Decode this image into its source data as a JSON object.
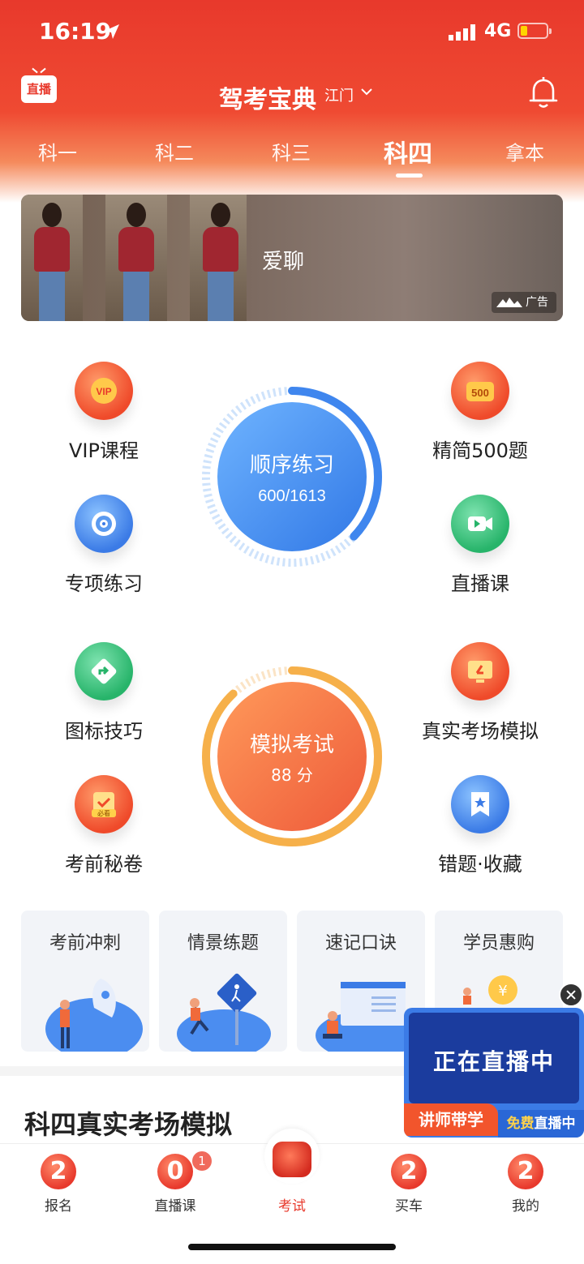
{
  "status": {
    "time": "16:19",
    "network": "4G"
  },
  "header": {
    "live_badge": "直播",
    "title": "驾考宝典",
    "city": "江门"
  },
  "tabs": [
    {
      "label": "科一"
    },
    {
      "label": "科二"
    },
    {
      "label": "科三"
    },
    {
      "label": "科四",
      "active": true
    },
    {
      "label": "拿本"
    }
  ],
  "banner": {
    "text": "爱聊",
    "ad_label": "广告"
  },
  "features_left": [
    {
      "label": "VIP课程",
      "icon": "vip-icon"
    },
    {
      "label": "专项练习",
      "icon": "target-icon"
    },
    {
      "label": "图标技巧",
      "icon": "road-sign-icon"
    },
    {
      "label": "考前秘卷",
      "icon": "clipboard-check-icon",
      "sub": "必看"
    }
  ],
  "features_right": [
    {
      "label": "精简500题",
      "icon": "500-badge-icon",
      "sub": "500"
    },
    {
      "label": "直播课",
      "icon": "video-camera-icon"
    },
    {
      "label": "真实考场模拟",
      "icon": "monitor-icon"
    },
    {
      "label": "错题·收藏",
      "icon": "bookmark-star-icon"
    }
  ],
  "practice": {
    "title": "顺序练习",
    "progress": "600/1613",
    "fraction": 0.372
  },
  "exam": {
    "title": "模拟考试",
    "score": "88 分",
    "fraction": 0.88
  },
  "cards": [
    {
      "label": "考前冲刺"
    },
    {
      "label": "情景练题"
    },
    {
      "label": "速记口诀"
    },
    {
      "label": "学员惠购"
    }
  ],
  "section_title": "科四真实考场模拟",
  "live_float": {
    "text": "正在直播中",
    "tag1": "讲师带学",
    "tag2_pre": "免费",
    "tag2_post": "直播中"
  },
  "bottom_nav": [
    {
      "label": "报名",
      "coin": "2"
    },
    {
      "label": "直播课",
      "coin": "0",
      "badge": "1"
    },
    {
      "label": "考试",
      "active": true
    },
    {
      "label": "买车",
      "coin": "2"
    },
    {
      "label": "我的",
      "coin": "2"
    }
  ],
  "colors": {
    "brand_red": "#e8392c",
    "practice_blue": "#3f86ee",
    "exam_orange": "#f2703e"
  }
}
